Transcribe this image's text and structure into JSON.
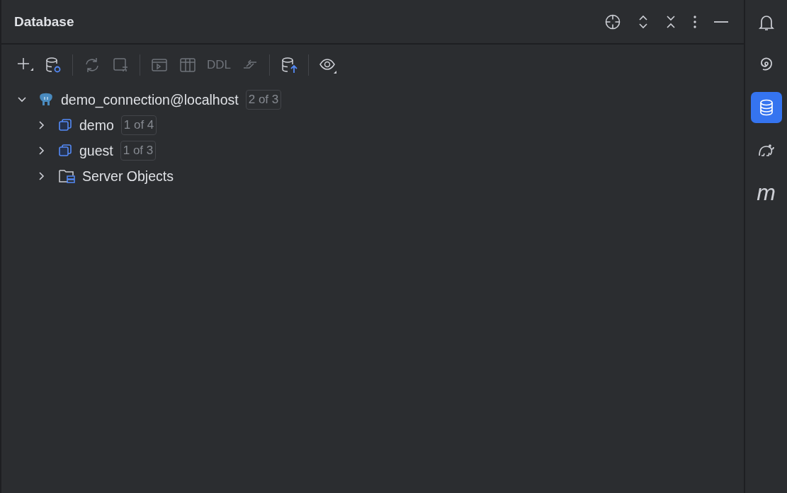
{
  "panel": {
    "title": "Database"
  },
  "toolbar": {
    "groups": [
      [
        {
          "disabled": false
        },
        {
          "disabled": false
        }
      ],
      [
        {
          "disabled": true
        },
        {
          "disabled": true
        }
      ],
      [
        {
          "disabled": true
        },
        {
          "disabled": true
        },
        {
          "disabled": true,
          "label": "DDL"
        },
        {
          "disabled": true
        }
      ],
      [
        {
          "disabled": false
        }
      ],
      [
        {
          "disabled": false
        }
      ]
    ]
  },
  "tree": [
    {
      "kind": "connection",
      "label": "demo_connection@localhost",
      "badge": "2 of 3",
      "expanded": true,
      "children": [
        {
          "kind": "schema",
          "label": "demo",
          "badge": "1 of 4",
          "expanded": false
        },
        {
          "kind": "schema",
          "label": "guest",
          "badge": "1 of 3",
          "expanded": false
        },
        {
          "kind": "folder",
          "label": "Server Objects",
          "expanded": false
        }
      ]
    }
  ],
  "sidebar": {
    "items": [
      {
        "selected": false
      },
      {
        "selected": false
      },
      {
        "selected": true
      },
      {
        "selected": false
      },
      {
        "selected": false,
        "label": "m"
      }
    ]
  }
}
